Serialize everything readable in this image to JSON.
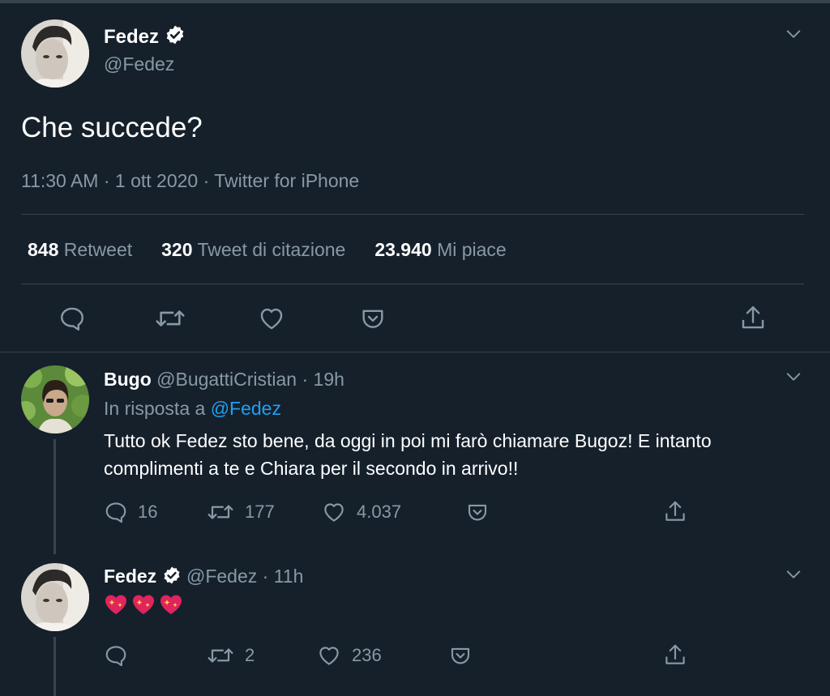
{
  "main_tweet": {
    "author_name": "Fedez",
    "handle": "@Fedez",
    "text": "Che succede?",
    "meta": "11:30 AM · 1 ott 2020 · Twitter for iPhone",
    "stats": [
      {
        "num": "848",
        "label": "Retweet"
      },
      {
        "num": "320",
        "label": "Tweet di citazione"
      },
      {
        "num": "23.940",
        "label": "Mi piace"
      }
    ]
  },
  "reply1": {
    "author_name": "Bugo",
    "handle": "@BugattiCristian",
    "dot": "·",
    "time": "19h",
    "reply_prefix": "In risposta a",
    "reply_to": "@Fedez",
    "text_line1": "Tutto ok Fedez sto bene, da oggi in poi mi farò chiamare Bugoz! E intanto",
    "text_line2": "complimenti a te e Chiara per il secondo in arrivo!!",
    "replies": "16",
    "retweets": "177",
    "likes": "4.037"
  },
  "reply2": {
    "author_name": "Fedez",
    "handle": "@Fedez",
    "dot": "·",
    "time": "11h",
    "emoji_names": [
      "sparkling-heart",
      "sparkling-heart",
      "sparkling-heart"
    ],
    "retweets": "2",
    "likes": "236"
  },
  "colors": {
    "background": "#15202b",
    "muted": "#8899a6",
    "link": "#1da1f2",
    "border": "#38444d",
    "verified": "#ffffff",
    "heart": "#e0245e"
  }
}
